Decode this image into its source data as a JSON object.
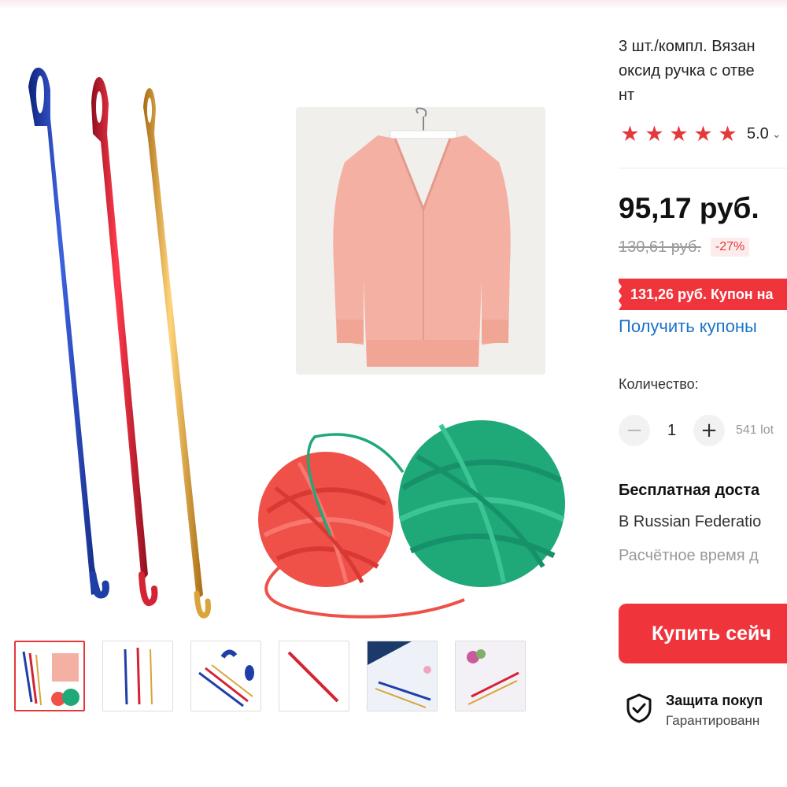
{
  "product": {
    "title_lines": [
      "3 шт./компл. Вязан",
      "оксид ручка с отве",
      "нт"
    ],
    "rating": {
      "stars": 5,
      "value": "5.0",
      "caret": "⌄"
    },
    "price": "95,17 руб.",
    "old_price": "130,61 руб.",
    "discount": "-27%",
    "coupon_text": "131,26 руб. Купон на",
    "get_coupons": "Получить купоны",
    "quantity": {
      "label": "Количество:",
      "value": "1",
      "minus": "−",
      "plus": "+",
      "lots": "541 lot"
    },
    "shipping": {
      "title": "Бесплатная доста",
      "destination": "В Russian Federatio",
      "eta": "Расчётное время д"
    },
    "buy_button": "Купить сейч",
    "protection": {
      "title": "Защита покуп",
      "subtitle": "Гарантированн"
    }
  },
  "gallery": {
    "selected_thumbnail": 1,
    "thumbnail_count": 6
  },
  "colors": {
    "accent": "#f0343c",
    "link": "#1a73c9",
    "hook_blue": "#1f3fa8",
    "hook_red": "#d42335",
    "hook_gold": "#d9a43a",
    "yarn_red": "#ef5047",
    "yarn_green": "#1fa878",
    "sweater": "#f4b1a3"
  }
}
